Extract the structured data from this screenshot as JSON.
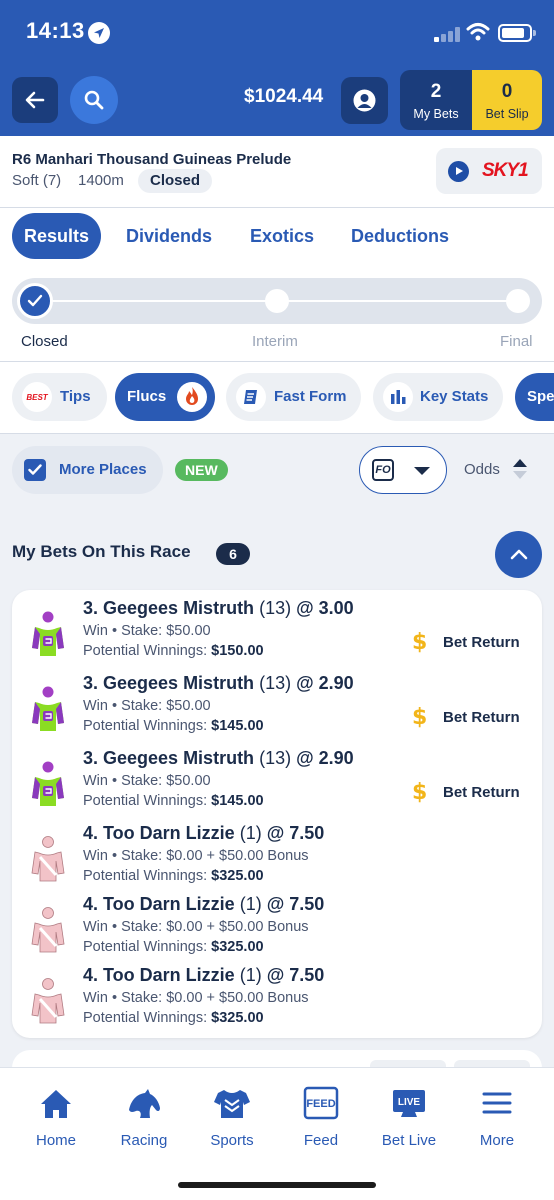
{
  "status_bar": {
    "time": "14:13"
  },
  "header": {
    "balance": "$1024.44",
    "my_bets_count": "2",
    "my_bets_label": "My Bets",
    "bet_slip_count": "0",
    "bet_slip_label": "Bet Slip"
  },
  "race": {
    "title": "R6 Manhari Thousand Guineas Prelude",
    "track": "Soft (7)",
    "distance": "1400m",
    "status": "Closed",
    "stream_brand": "SKY1"
  },
  "tabs": [
    "Results",
    "Dividends",
    "Exotics",
    "Deductions"
  ],
  "progress": {
    "steps": [
      "Closed",
      "Interim",
      "Final"
    ],
    "current_step": 1
  },
  "chips": [
    "Tips",
    "Flucs",
    "Fast Form",
    "Key Stats",
    "Spe"
  ],
  "options": {
    "more_places": "More Places",
    "new_badge": "NEW",
    "format_badge": "FO",
    "odds_label": "Odds"
  },
  "my_bets": {
    "title": "My Bets On This Race",
    "count": "6",
    "bets": [
      {
        "runner": "3. Geegees Mistruth",
        "barrier": "(13)",
        "odds": "@ 3.00",
        "line": "Win • Stake: $50.00",
        "pot_label": "Potential Winnings:",
        "pot_value": "$150.00",
        "return_label": "Bet Return",
        "silk": "green"
      },
      {
        "runner": "3. Geegees Mistruth",
        "barrier": "(13)",
        "odds": "@ 2.90",
        "line": "Win • Stake: $50.00",
        "pot_label": "Potential Winnings:",
        "pot_value": "$145.00",
        "return_label": "Bet Return",
        "silk": "green"
      },
      {
        "runner": "3. Geegees Mistruth",
        "barrier": "(13)",
        "odds": "@ 2.90",
        "line": "Win • Stake: $50.00",
        "pot_label": "Potential Winnings:",
        "pot_value": "$145.00",
        "return_label": "Bet Return",
        "silk": "green"
      },
      {
        "runner": "4. Too Darn Lizzie",
        "barrier": "(1)",
        "odds": "@ 7.50",
        "line": "Win • Stake: $0.00 + $50.00 Bonus",
        "pot_label": "Potential Winnings:",
        "pot_value": "$325.00",
        "silk": "pink"
      },
      {
        "runner": "4. Too Darn Lizzie",
        "barrier": "(1)",
        "odds": "@ 7.50",
        "line": "Win • Stake: $0.00 + $50.00 Bonus",
        "pot_label": "Potential Winnings:",
        "pot_value": "$325.00",
        "silk": "pink"
      },
      {
        "runner": "4. Too Darn Lizzie",
        "barrier": "(1)",
        "odds": "@ 7.50",
        "line": "Win • Stake: $0.00 + $50.00 Bonus",
        "pot_label": "Potential Winnings:",
        "pot_value": "$325.00",
        "silk": "pink"
      }
    ]
  },
  "bottom_nav": [
    {
      "label": "Home",
      "icon": "home-icon"
    },
    {
      "label": "Racing",
      "icon": "horse-icon",
      "active": true
    },
    {
      "label": "Sports",
      "icon": "jersey-icon"
    },
    {
      "label": "Feed",
      "icon": "feed-icon"
    },
    {
      "label": "Bet Live",
      "icon": "live-icon"
    },
    {
      "label": "More",
      "icon": "menu-icon"
    }
  ],
  "colors": {
    "primary": "#2a5ab4",
    "dark": "#1b3d7c",
    "accent_yellow": "#f5cd2c",
    "new_green": "#57b95f",
    "sky_red": "#e3141f",
    "dollar": "#f2b51a"
  }
}
